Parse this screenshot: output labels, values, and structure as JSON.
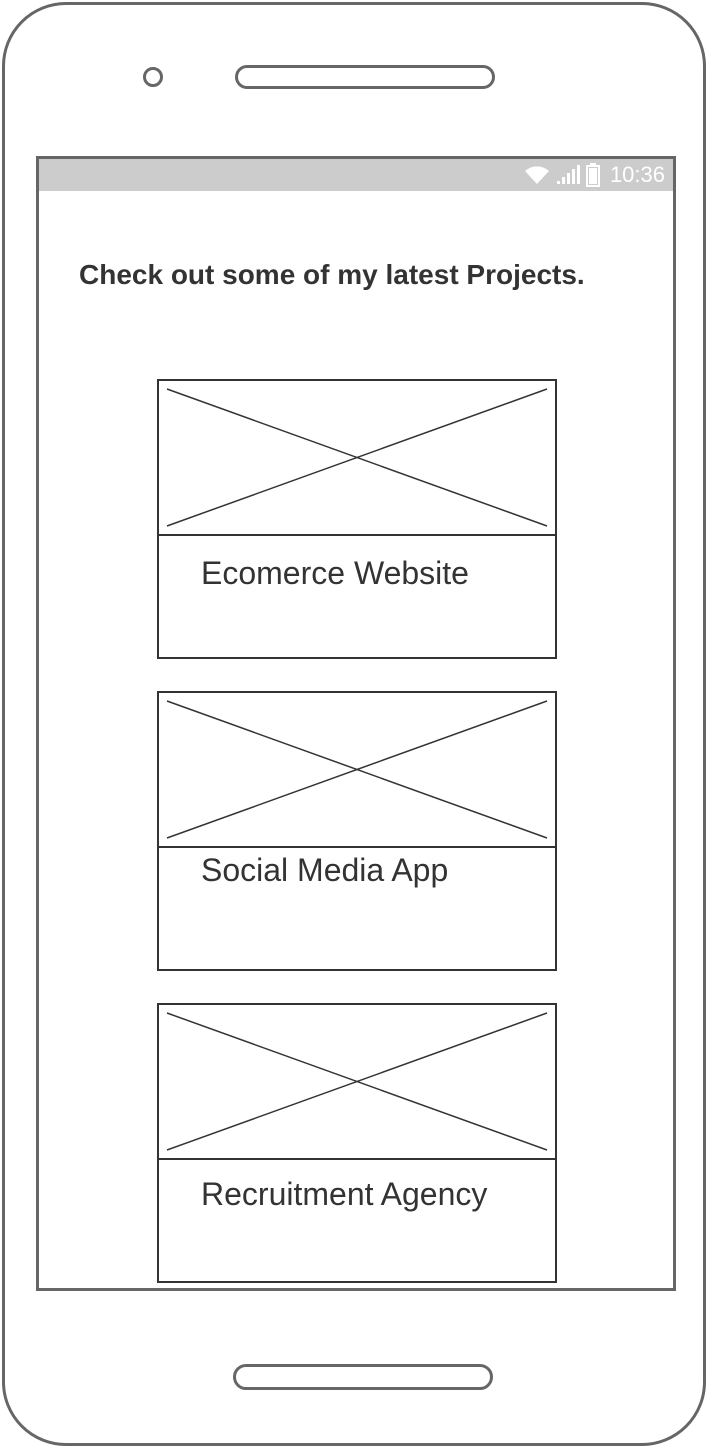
{
  "status_bar": {
    "time": "10:36",
    "icons": [
      "wifi-icon",
      "signal-icon",
      "battery-icon"
    ]
  },
  "page": {
    "headline": "Check out some of my latest Projects."
  },
  "projects": [
    {
      "title": "Ecomerce Website",
      "image": "image-placeholder-icon"
    },
    {
      "title": "Social Media App",
      "image": "image-placeholder-icon"
    },
    {
      "title": "Recruitment Agency",
      "image": "image-placeholder-icon"
    }
  ],
  "colors": {
    "frame": "#666666",
    "status_bar": "#cccccc",
    "text": "#333333"
  }
}
